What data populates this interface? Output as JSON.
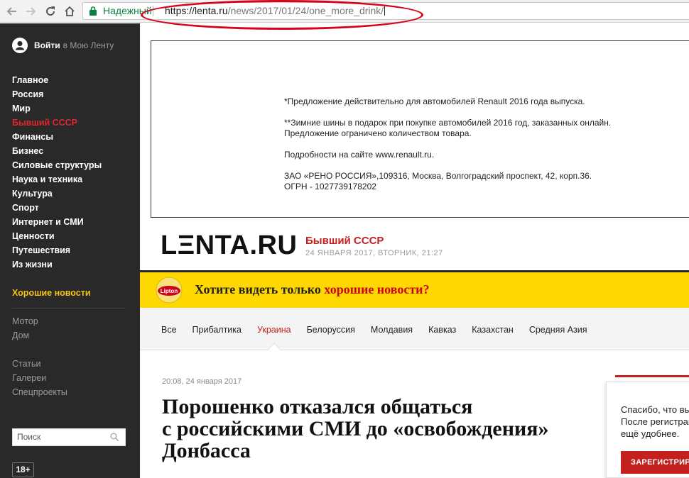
{
  "browser": {
    "secure_label": "Надежный",
    "url_host": "https://lenta.ru",
    "url_path": "/news/2017/01/24/one_more_drink/"
  },
  "sidebar": {
    "login_link": "Войти",
    "login_rest": "в Мою Ленту",
    "menu": [
      "Главное",
      "Россия",
      "Мир",
      "Бывший СССР",
      "Финансы",
      "Бизнес",
      "Силовые структуры",
      "Наука и техника",
      "Культура",
      "Спорт",
      "Интернет и СМИ",
      "Ценности",
      "Путешествия",
      "Из жизни"
    ],
    "active_item": "Бывший СССР",
    "good_news": "Хорошие новости",
    "menu2": [
      "Мотор",
      "Дом"
    ],
    "menu3": [
      "Статьи",
      "Галереи",
      "Спецпроекты"
    ],
    "search_placeholder": "Поиск",
    "age_rating": "18+"
  },
  "ad": {
    "line1": "*Предложение действительно для автомобилей Renault 2016 года выпуска.",
    "line2a": "**Зимние шины в подарок при покупке автомобилей 2016 год, заказанных онлайн.",
    "line2b": "Предложение ограничено количеством товара.",
    "line3": "Подробности на сайте www.renault.ru.",
    "line4a": "ЗАО «РЕНО РОССИЯ»,109316, Москва, Волгоградский проспект, 42, корп.36.",
    "line4b": "ОГРН - 1027739178202"
  },
  "header": {
    "logo": "LΞNTA.RU",
    "section": "Бывший СССР",
    "dateline": "24 ЯНВАРЯ 2017, ВТОРНИК, 21:27"
  },
  "banner": {
    "badge": "Lipton",
    "text_before": "Хотите видеть только ",
    "text_highlight": "хорошие новости?"
  },
  "subnav": {
    "tabs": [
      "Все",
      "Прибалтика",
      "Украина",
      "Белоруссия",
      "Молдавия",
      "Кавказ",
      "Казахстан",
      "Средняя Азия"
    ],
    "active_tab": "Украина"
  },
  "article": {
    "time": "20:08, 24 января 2017",
    "title_line1": "Порошенко отказался общаться",
    "title_line2": "с российскими СМИ до «освобождения»",
    "title_line3": "Донбасса"
  },
  "popup": {
    "line1": "Спасибо, что вы",
    "line2": "После регистрации",
    "line3": "ещё удобнее.",
    "button": "ЗАРЕГИСТРИРОВАТЬСЯ"
  },
  "colors": {
    "accent_red": "#c52020",
    "sidebar_bg": "#292929",
    "banner_yellow": "#fed800",
    "secure_green": "#0b8043"
  }
}
